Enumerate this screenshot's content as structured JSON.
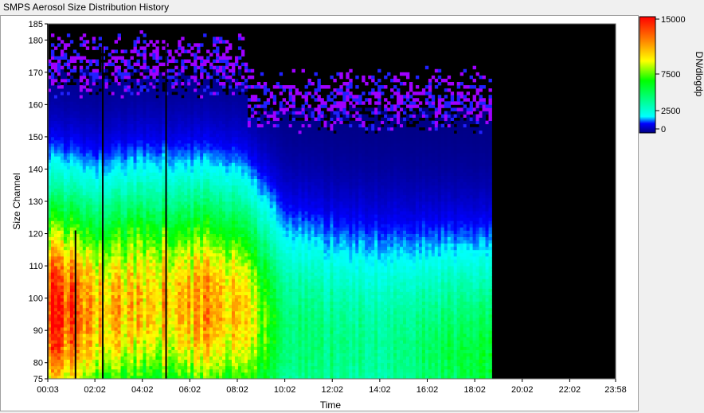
{
  "window": {
    "title": "SMPS Aerosol Size Distribution History"
  },
  "chart_data": {
    "type": "heatmap",
    "title": "SMPS Aerosol Size Distribution History",
    "xlabel": "Time",
    "ylabel": "Size Channel",
    "x_ticks": [
      "00:03",
      "02:02",
      "04:02",
      "06:02",
      "08:02",
      "10:02",
      "12:02",
      "14:02",
      "16:02",
      "18:02",
      "20:02",
      "22:02",
      "23:58"
    ],
    "y_ticks": [
      75,
      80,
      90,
      100,
      110,
      120,
      130,
      140,
      150,
      160,
      170,
      180,
      185
    ],
    "ylim": [
      75,
      185
    ],
    "x_range": [
      "00:03",
      "23:58"
    ],
    "data_end": "18:45",
    "colorbar": {
      "label": "DN/dlogdp",
      "ticks": [
        0,
        2500,
        7500,
        15000
      ],
      "range": [
        0,
        15000
      ],
      "colors": [
        "#000080",
        "#0000ff",
        "#00ffff",
        "#00ff00",
        "#ffff00",
        "#ff8000",
        "#ff0000"
      ]
    },
    "peak_channel_profile": [
      {
        "time": "00:03",
        "peak_channel": 95,
        "intensity": 15000
      },
      {
        "time": "02:02",
        "peak_channel": 95,
        "intensity": 11000
      },
      {
        "time": "04:02",
        "peak_channel": 98,
        "intensity": 10500
      },
      {
        "time": "06:02",
        "peak_channel": 97,
        "intensity": 11000
      },
      {
        "time": "08:02",
        "peak_channel": 96,
        "intensity": 11000
      },
      {
        "time": "10:02",
        "peak_channel": 88,
        "intensity": 4500
      },
      {
        "time": "12:02",
        "peak_channel": 85,
        "intensity": 4500
      },
      {
        "time": "14:02",
        "peak_channel": 85,
        "intensity": 4000
      },
      {
        "time": "16:02",
        "peak_channel": 82,
        "intensity": 5000
      },
      {
        "time": "18:02",
        "peak_channel": 80,
        "intensity": 5500
      }
    ]
  }
}
